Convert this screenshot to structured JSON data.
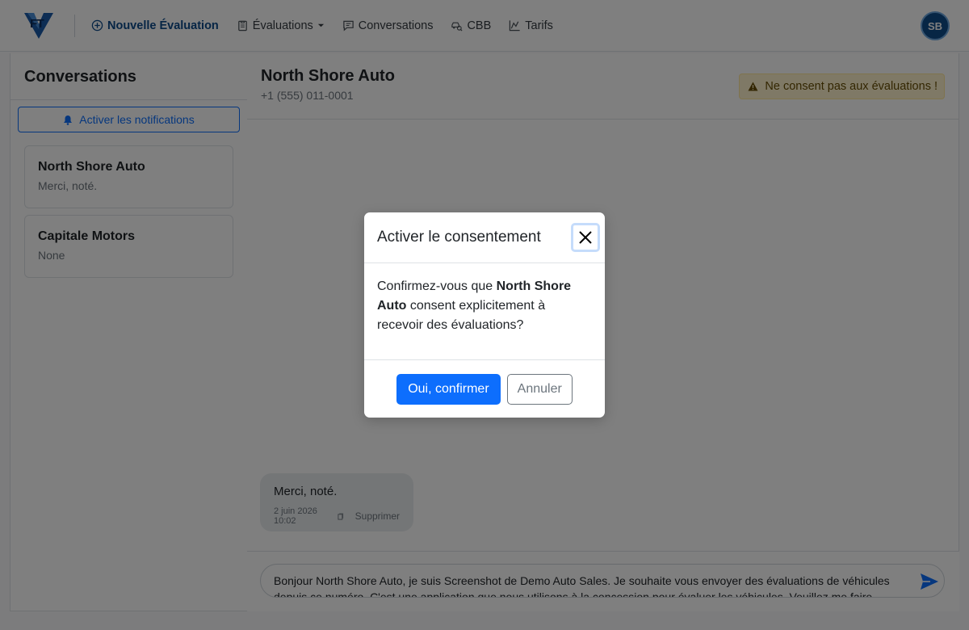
{
  "navbar": {
    "logo_text": "FT",
    "links": [
      {
        "label": "Nouvelle Évaluation",
        "icon": "plus-circle-icon"
      },
      {
        "label": "Évaluations",
        "icon": "clipboard-icon"
      },
      {
        "label": "Conversations",
        "icon": "chat-icon"
      },
      {
        "label": "CBB",
        "icon": "car-search-icon"
      },
      {
        "label": "Tarifs",
        "icon": "chart-icon"
      }
    ],
    "avatar_initials": "SB"
  },
  "sidebar": {
    "title": "Conversations",
    "notifications_button": "Activer les notifications",
    "conversations": [
      {
        "name": "North Shore Auto",
        "preview": "Merci, noté."
      },
      {
        "name": "Capitale Motors",
        "preview": "None"
      }
    ]
  },
  "chat": {
    "title": "North Shore Auto",
    "phone": "+1 (555) 011-0001",
    "consent_warning": "Ne consent pas aux évaluations !",
    "messages": [
      {
        "text": "Merci, noté.",
        "timestamp": "2 juin 2026 10:02",
        "delete_label": "Supprimer"
      }
    ],
    "composer_text": "Bonjour North Shore Auto, je suis Screenshot de Demo Auto Sales. Je souhaite vous envoyer des évaluations de véhicules depuis ce numéro. C'est une application que nous utilisons à la concession pour évaluer les véhicules. Veuillez me faire savoir"
  },
  "modal": {
    "title": "Activer le consentement",
    "body_prefix": "Confirmez-vous que ",
    "body_name": "North Shore Auto",
    "body_suffix": " consent explicitement à recevoir des évaluations?",
    "confirm_label": "Oui, confirmer",
    "cancel_label": "Annuler"
  },
  "colors": {
    "primary": "#0d6efd",
    "brand_dark": "#0d2c5a",
    "warning_bg": "#fff3cd"
  }
}
